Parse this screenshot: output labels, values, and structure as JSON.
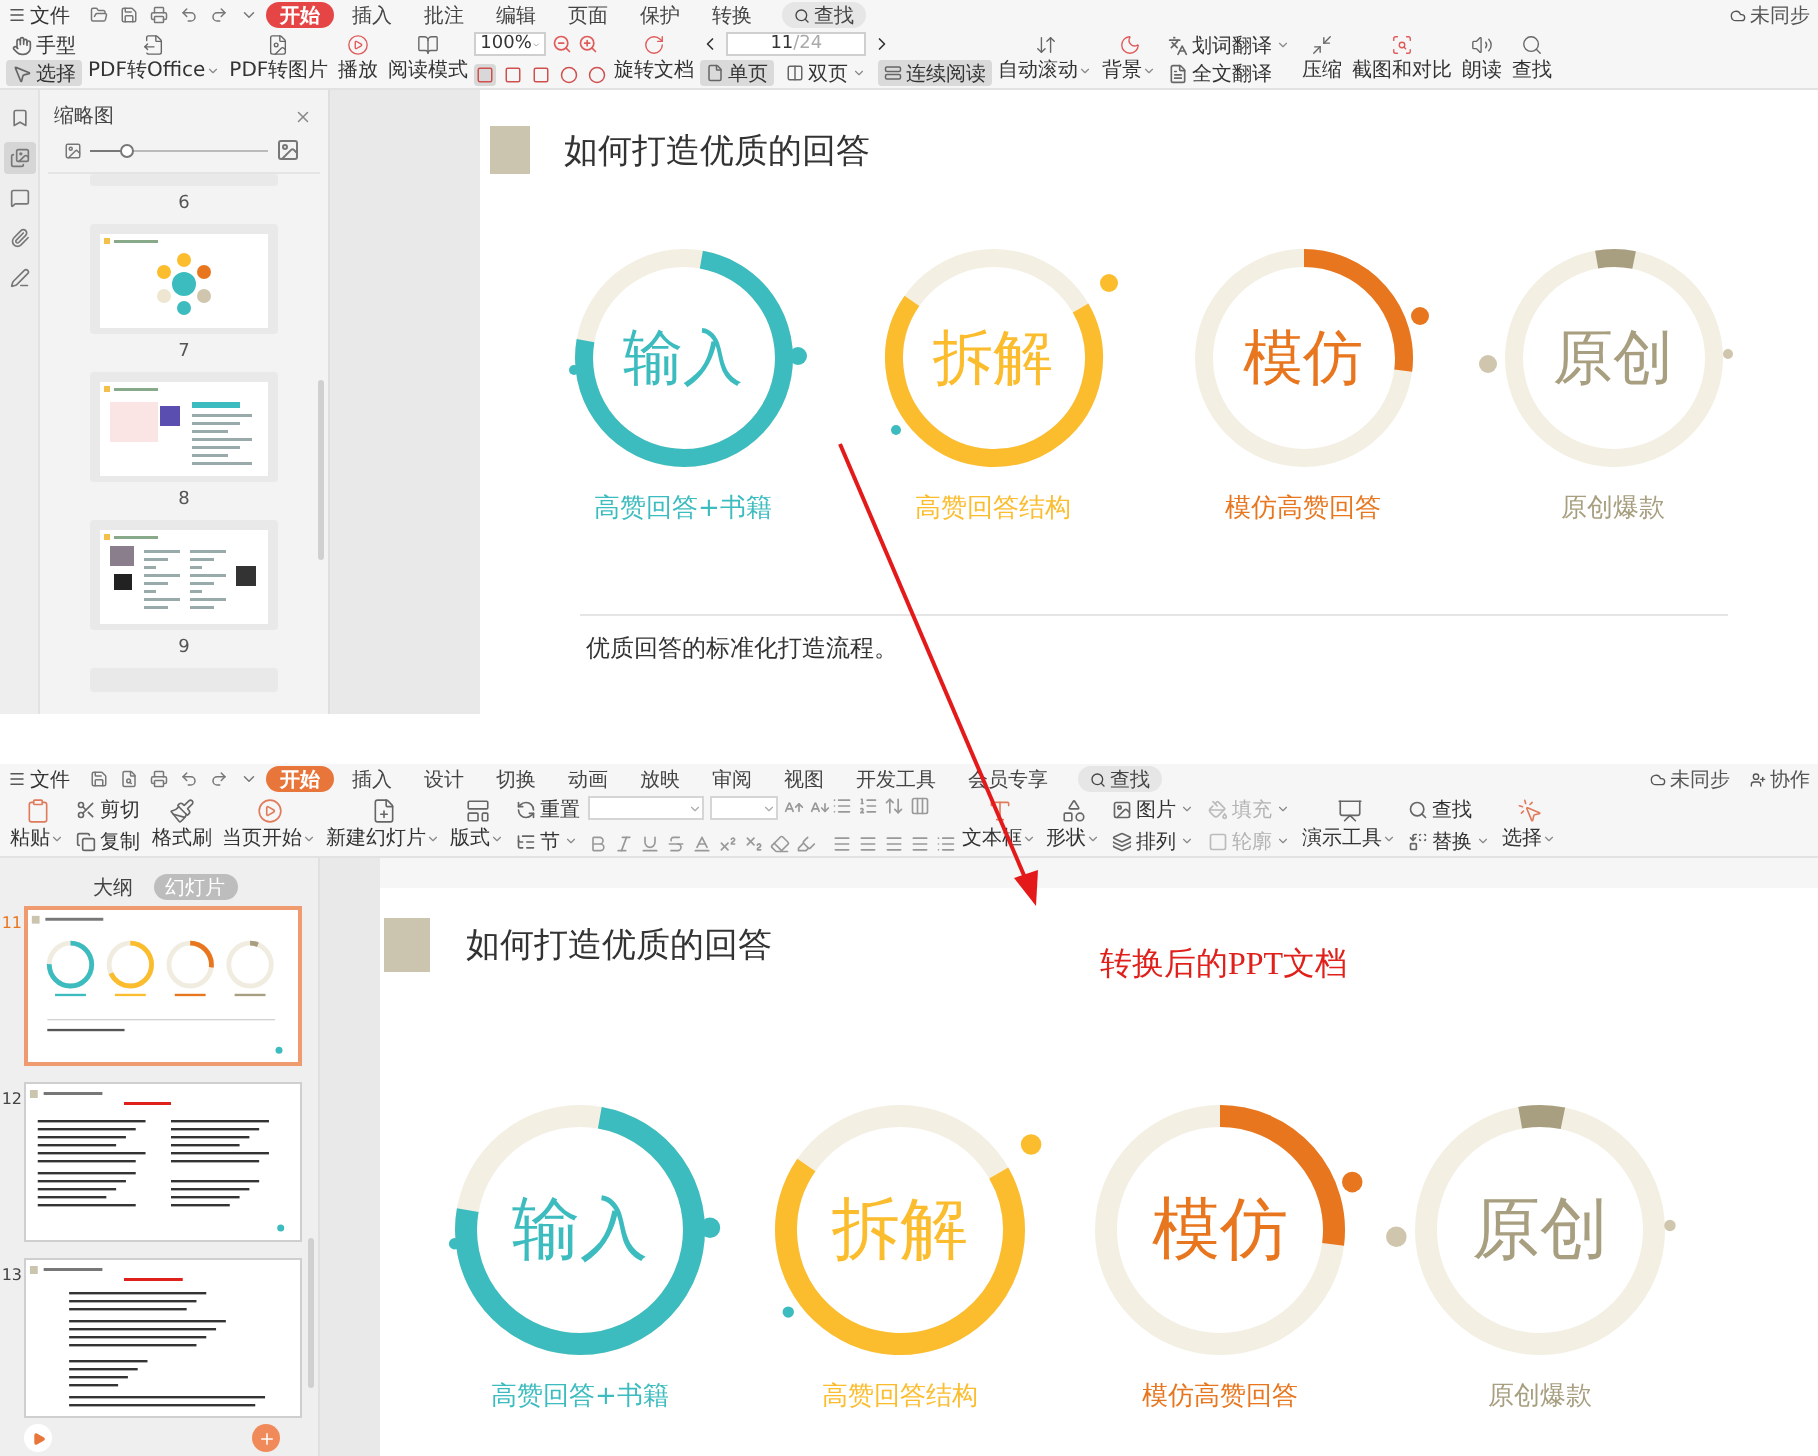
{
  "pdf_window": {
    "menu_bar": {
      "file_menu": "文件",
      "tabs": [
        {
          "label": "开始",
          "selected": true
        },
        {
          "label": "插入",
          "selected": false
        },
        {
          "label": "批注",
          "selected": false
        },
        {
          "label": "编辑",
          "selected": false
        },
        {
          "label": "页面",
          "selected": false
        },
        {
          "label": "保护",
          "selected": false
        },
        {
          "label": "转换",
          "selected": false
        }
      ],
      "search": "查找",
      "status": [
        "未同步"
      ]
    },
    "toolbar": [
      {
        "kind": "stack",
        "items": [
          {
            "label": "手型",
            "selected": false,
            "dropdown": false
          },
          {
            "label": "选择",
            "selected": true,
            "dropdown": false
          }
        ]
      },
      {
        "kind": "large",
        "label": "PDF转Office",
        "dropdown": true
      },
      {
        "kind": "large",
        "label": "PDF转图片",
        "dropdown": false
      },
      {
        "kind": "large",
        "label": "播放",
        "dropdown": false
      },
      {
        "kind": "large",
        "label": "阅读模式",
        "dropdown": false
      },
      {
        "kind": "zoom",
        "value": "100%",
        "shape_tools": [
          {
            "selected": true
          },
          {
            "selected": false
          },
          {
            "selected": false
          },
          {
            "selected": false
          },
          {
            "selected": false
          }
        ]
      },
      {
        "kind": "large",
        "label": "旋转文档",
        "dropdown": false
      },
      {
        "kind": "pager",
        "current": "11",
        "total": "/24",
        "views": [
          {
            "label": "单页",
            "selected": true,
            "dropdown": false
          },
          {
            "label": "双页",
            "selected": false,
            "dropdown": true
          },
          {
            "label": "连续阅读",
            "selected": true,
            "dropdown": false
          }
        ]
      },
      {
        "kind": "large",
        "label": "自动滚动",
        "dropdown": true
      },
      {
        "kind": "large",
        "label": "背景",
        "dropdown": true
      },
      {
        "kind": "stack",
        "items": [
          {
            "label": "划词翻译",
            "selected": false,
            "dropdown": true
          },
          {
            "label": "全文翻译",
            "selected": false,
            "dropdown": false
          }
        ]
      },
      {
        "kind": "large",
        "label": "压缩",
        "dropdown": false
      },
      {
        "kind": "large",
        "label": "截图和对比",
        "dropdown": false
      },
      {
        "kind": "large",
        "label": "朗读",
        "dropdown": false
      },
      {
        "kind": "large",
        "label": "查找",
        "dropdown": false
      }
    ],
    "rail": [
      {
        "selected": false
      },
      {
        "selected": true
      },
      {
        "selected": false
      },
      {
        "selected": false
      },
      {
        "selected": false
      }
    ],
    "thumbnails": {
      "title": "缩略图",
      "zoom_slider": {
        "level": 0.2
      },
      "pages": [
        {
          "number": "6"
        },
        {
          "number": "7"
        },
        {
          "number": "8"
        },
        {
          "number": "9"
        }
      ]
    },
    "page": {
      "title": "如何打造优质的回答",
      "steps": [
        {
          "label": "输入",
          "caption": "高赞回答+书籍",
          "color": "#3dbcbf"
        },
        {
          "label": "拆解",
          "caption": "高赞回答结构",
          "color": "#fbbd2e"
        },
        {
          "label": "模仿",
          "caption": "模仿高赞回答",
          "color": "#e8761e"
        },
        {
          "label": "原创",
          "caption": "原创爆款",
          "color": "#a89f80"
        }
      ],
      "footer": "优质回答的标准化打造流程。"
    }
  },
  "ppt_window": {
    "menu_bar": {
      "file_menu": "文件",
      "tabs": [
        {
          "label": "开始",
          "selected": true
        },
        {
          "label": "插入",
          "selected": false
        },
        {
          "label": "设计",
          "selected": false
        },
        {
          "label": "切换",
          "selected": false
        },
        {
          "label": "动画",
          "selected": false
        },
        {
          "label": "放映",
          "selected": false
        },
        {
          "label": "审阅",
          "selected": false
        },
        {
          "label": "视图",
          "selected": false
        },
        {
          "label": "开发工具",
          "selected": false
        },
        {
          "label": "会员专享",
          "selected": false
        }
      ],
      "search": "查找",
      "status": [
        "未同步",
        "协作"
      ]
    },
    "toolbar": [
      {
        "kind": "large",
        "label": "粘贴",
        "dropdown": true
      },
      {
        "kind": "stack",
        "items": [
          {
            "label": "剪切",
            "dropdown": false,
            "disabled": false
          },
          {
            "label": "复制",
            "dropdown": false,
            "disabled": false
          }
        ]
      },
      {
        "kind": "large",
        "label": "格式刷",
        "dropdown": false
      },
      {
        "kind": "large",
        "label": "当页开始",
        "dropdown": true
      },
      {
        "kind": "large",
        "label": "新建幻灯片",
        "dropdown": true
      },
      {
        "kind": "large",
        "label": "版式",
        "dropdown": true
      },
      {
        "kind": "stack",
        "items": [
          {
            "label": "重置",
            "dropdown": false,
            "disabled": false
          },
          {
            "label": "节",
            "dropdown": true,
            "disabled": false
          }
        ]
      },
      {
        "kind": "font"
      },
      {
        "kind": "paragraph"
      },
      {
        "kind": "large",
        "label": "文本框",
        "dropdown": true
      },
      {
        "kind": "large",
        "label": "形状",
        "dropdown": true
      },
      {
        "kind": "stack",
        "items": [
          {
            "label": "图片",
            "dropdown": true,
            "disabled": false
          },
          {
            "label": "排列",
            "dropdown": true,
            "disabled": false
          }
        ]
      },
      {
        "kind": "stack",
        "items": [
          {
            "label": "填充",
            "dropdown": true,
            "disabled": true
          },
          {
            "label": "轮廓",
            "dropdown": true,
            "disabled": true
          }
        ]
      },
      {
        "kind": "large",
        "label": "演示工具",
        "dropdown": true
      },
      {
        "kind": "stack",
        "items": [
          {
            "label": "查找",
            "dropdown": false,
            "disabled": false
          },
          {
            "label": "替换",
            "dropdown": true,
            "disabled": false
          }
        ]
      },
      {
        "kind": "large",
        "label": "选择",
        "dropdown": true
      }
    ],
    "panel_tabs": [
      {
        "label": "大纲",
        "selected": false
      },
      {
        "label": "幻灯片",
        "selected": true
      }
    ],
    "slides": [
      {
        "number": "11",
        "selected": true
      },
      {
        "number": "12",
        "selected": false
      },
      {
        "number": "13",
        "selected": false
      }
    ],
    "slide": {
      "title": "如何打造优质的回答",
      "steps": [
        {
          "label": "输入",
          "caption": "高赞回答+书籍",
          "color": "#3dbcbf"
        },
        {
          "label": "拆解",
          "caption": "高赞回答结构",
          "color": "#fbbd2e"
        },
        {
          "label": "模仿",
          "caption": "模仿高赞回答",
          "color": "#e8761e"
        },
        {
          "label": "原创",
          "caption": "原创爆款",
          "color": "#a89f80"
        }
      ]
    }
  },
  "annotation": "转换后的PPT文档"
}
